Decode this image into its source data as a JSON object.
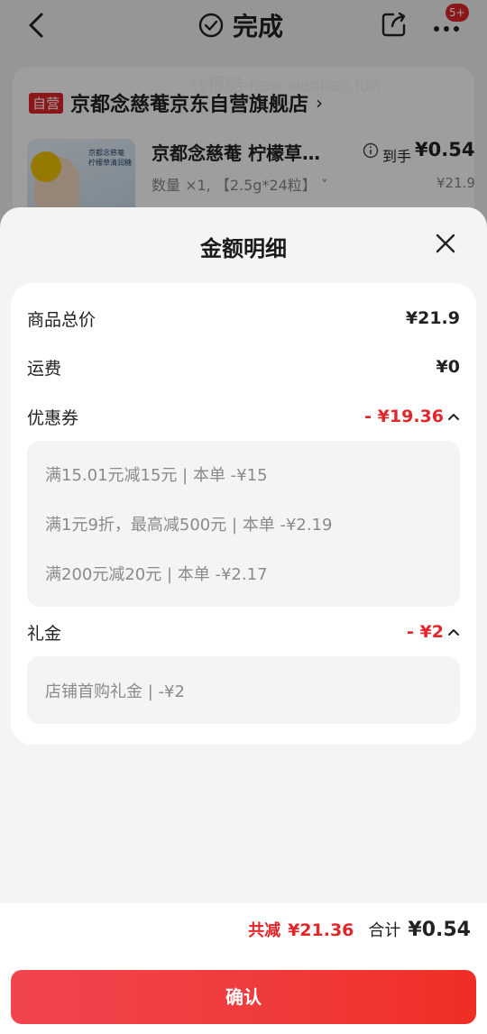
{
  "topbar": {
    "title": "完成",
    "badge": "5+"
  },
  "watermark": "线报酷-new.xianbao.fun",
  "store": {
    "tag": "自营",
    "name": "京都念慈菴京东自营旗舰店",
    "chevron": "›"
  },
  "product": {
    "image_text": "京都念慈菴 柠檬草清润糖",
    "title": "京都念慈菴 柠檬草…",
    "spec": "数量 ×1, 【2.5g*24粒】 ˅",
    "price_label": "到手",
    "price": "¥0.54",
    "original_price": "¥21.9"
  },
  "sheet": {
    "title": "金额明细",
    "rows": {
      "subtotal": {
        "label": "商品总价",
        "value": "¥21.9"
      },
      "shipping": {
        "label": "运费",
        "value": "¥0"
      },
      "coupon": {
        "label": "优惠券",
        "value": "- ¥19.36"
      },
      "gift": {
        "label": "礼金",
        "value": "- ¥2"
      }
    },
    "coupon_items": [
      "满15.01元减15元 | 本单 -¥15",
      "满1元9折，最高减500元 | 本单 -¥2.19",
      "满200元减20元 | 本单 -¥2.17"
    ],
    "gift_items": [
      "店铺首购礼金 | -¥2"
    ]
  },
  "footer": {
    "save_label": "共减",
    "save_value": "¥21.36",
    "total_label": "合计",
    "total_value": "¥0.54",
    "confirm": "确认"
  },
  "colors": {
    "accent_red": "#e3262a",
    "button_gradient_start": "#f2444e",
    "button_gradient_end": "#ef2e24"
  }
}
